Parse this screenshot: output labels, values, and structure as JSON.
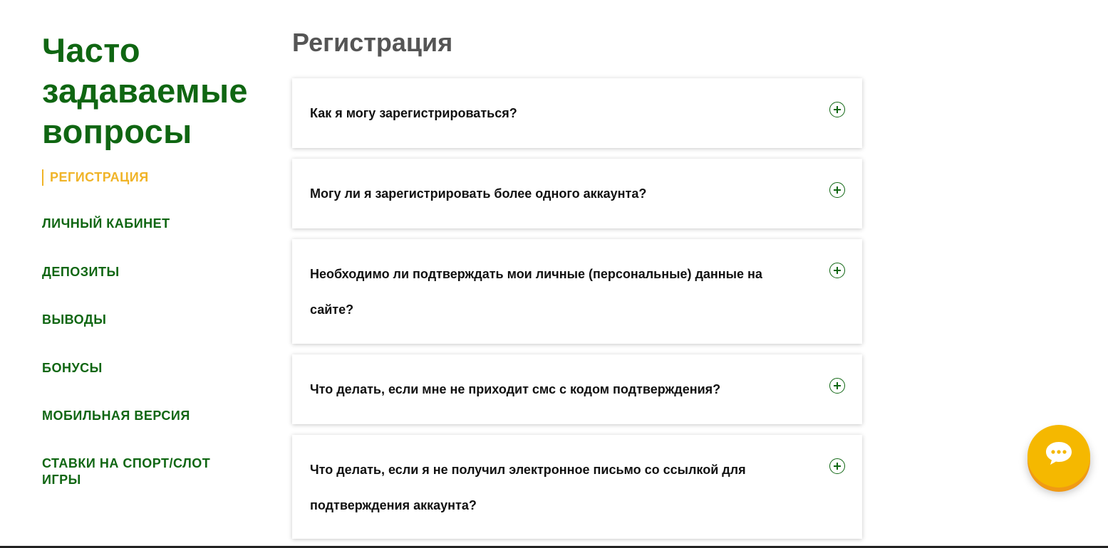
{
  "sidebar": {
    "title": "Часто задаваемые вопросы",
    "items": [
      {
        "label": "РЕГИСТРАЦИЯ"
      },
      {
        "label": "ЛИЧНЫЙ КАБИНЕТ"
      },
      {
        "label": "ДЕПОЗИТЫ"
      },
      {
        "label": "ВЫВОДЫ"
      },
      {
        "label": "БОНУСЫ"
      },
      {
        "label": "МОБИЛЬНАЯ ВЕРСИЯ"
      },
      {
        "label": "СТАВКИ НА СПОРТ/СЛОТ ИГРЫ"
      }
    ],
    "active_index": 0
  },
  "main": {
    "section_title": "Регистрация",
    "questions": [
      {
        "text": "Как я могу зарегистрироваться?",
        "icon": "plus-circle-icon"
      },
      {
        "text": "Могу ли я зарегистрировать более одного аккаунта?",
        "icon": "plus-circle-icon"
      },
      {
        "text": "Необходимо ли подтверждать мои личные (персональные) данные на сайте?",
        "icon": "plus-circle-icon"
      },
      {
        "text": "Что делать, если мне не приходит смс с кодом подтверждения?",
        "icon": "plus-circle-icon"
      },
      {
        "text": "Что делать, если я не получил электронное письмо со ссылкой для подтверждения аккаунта?",
        "icon": "plus-circle-icon"
      }
    ]
  },
  "chat": {
    "icon": "chat-bubble-icon"
  },
  "colors": {
    "primary_green": "#0f6612",
    "accent_yellow": "#f0b428",
    "chat_yellow": "#f5b800",
    "heading_gray": "#555555"
  }
}
